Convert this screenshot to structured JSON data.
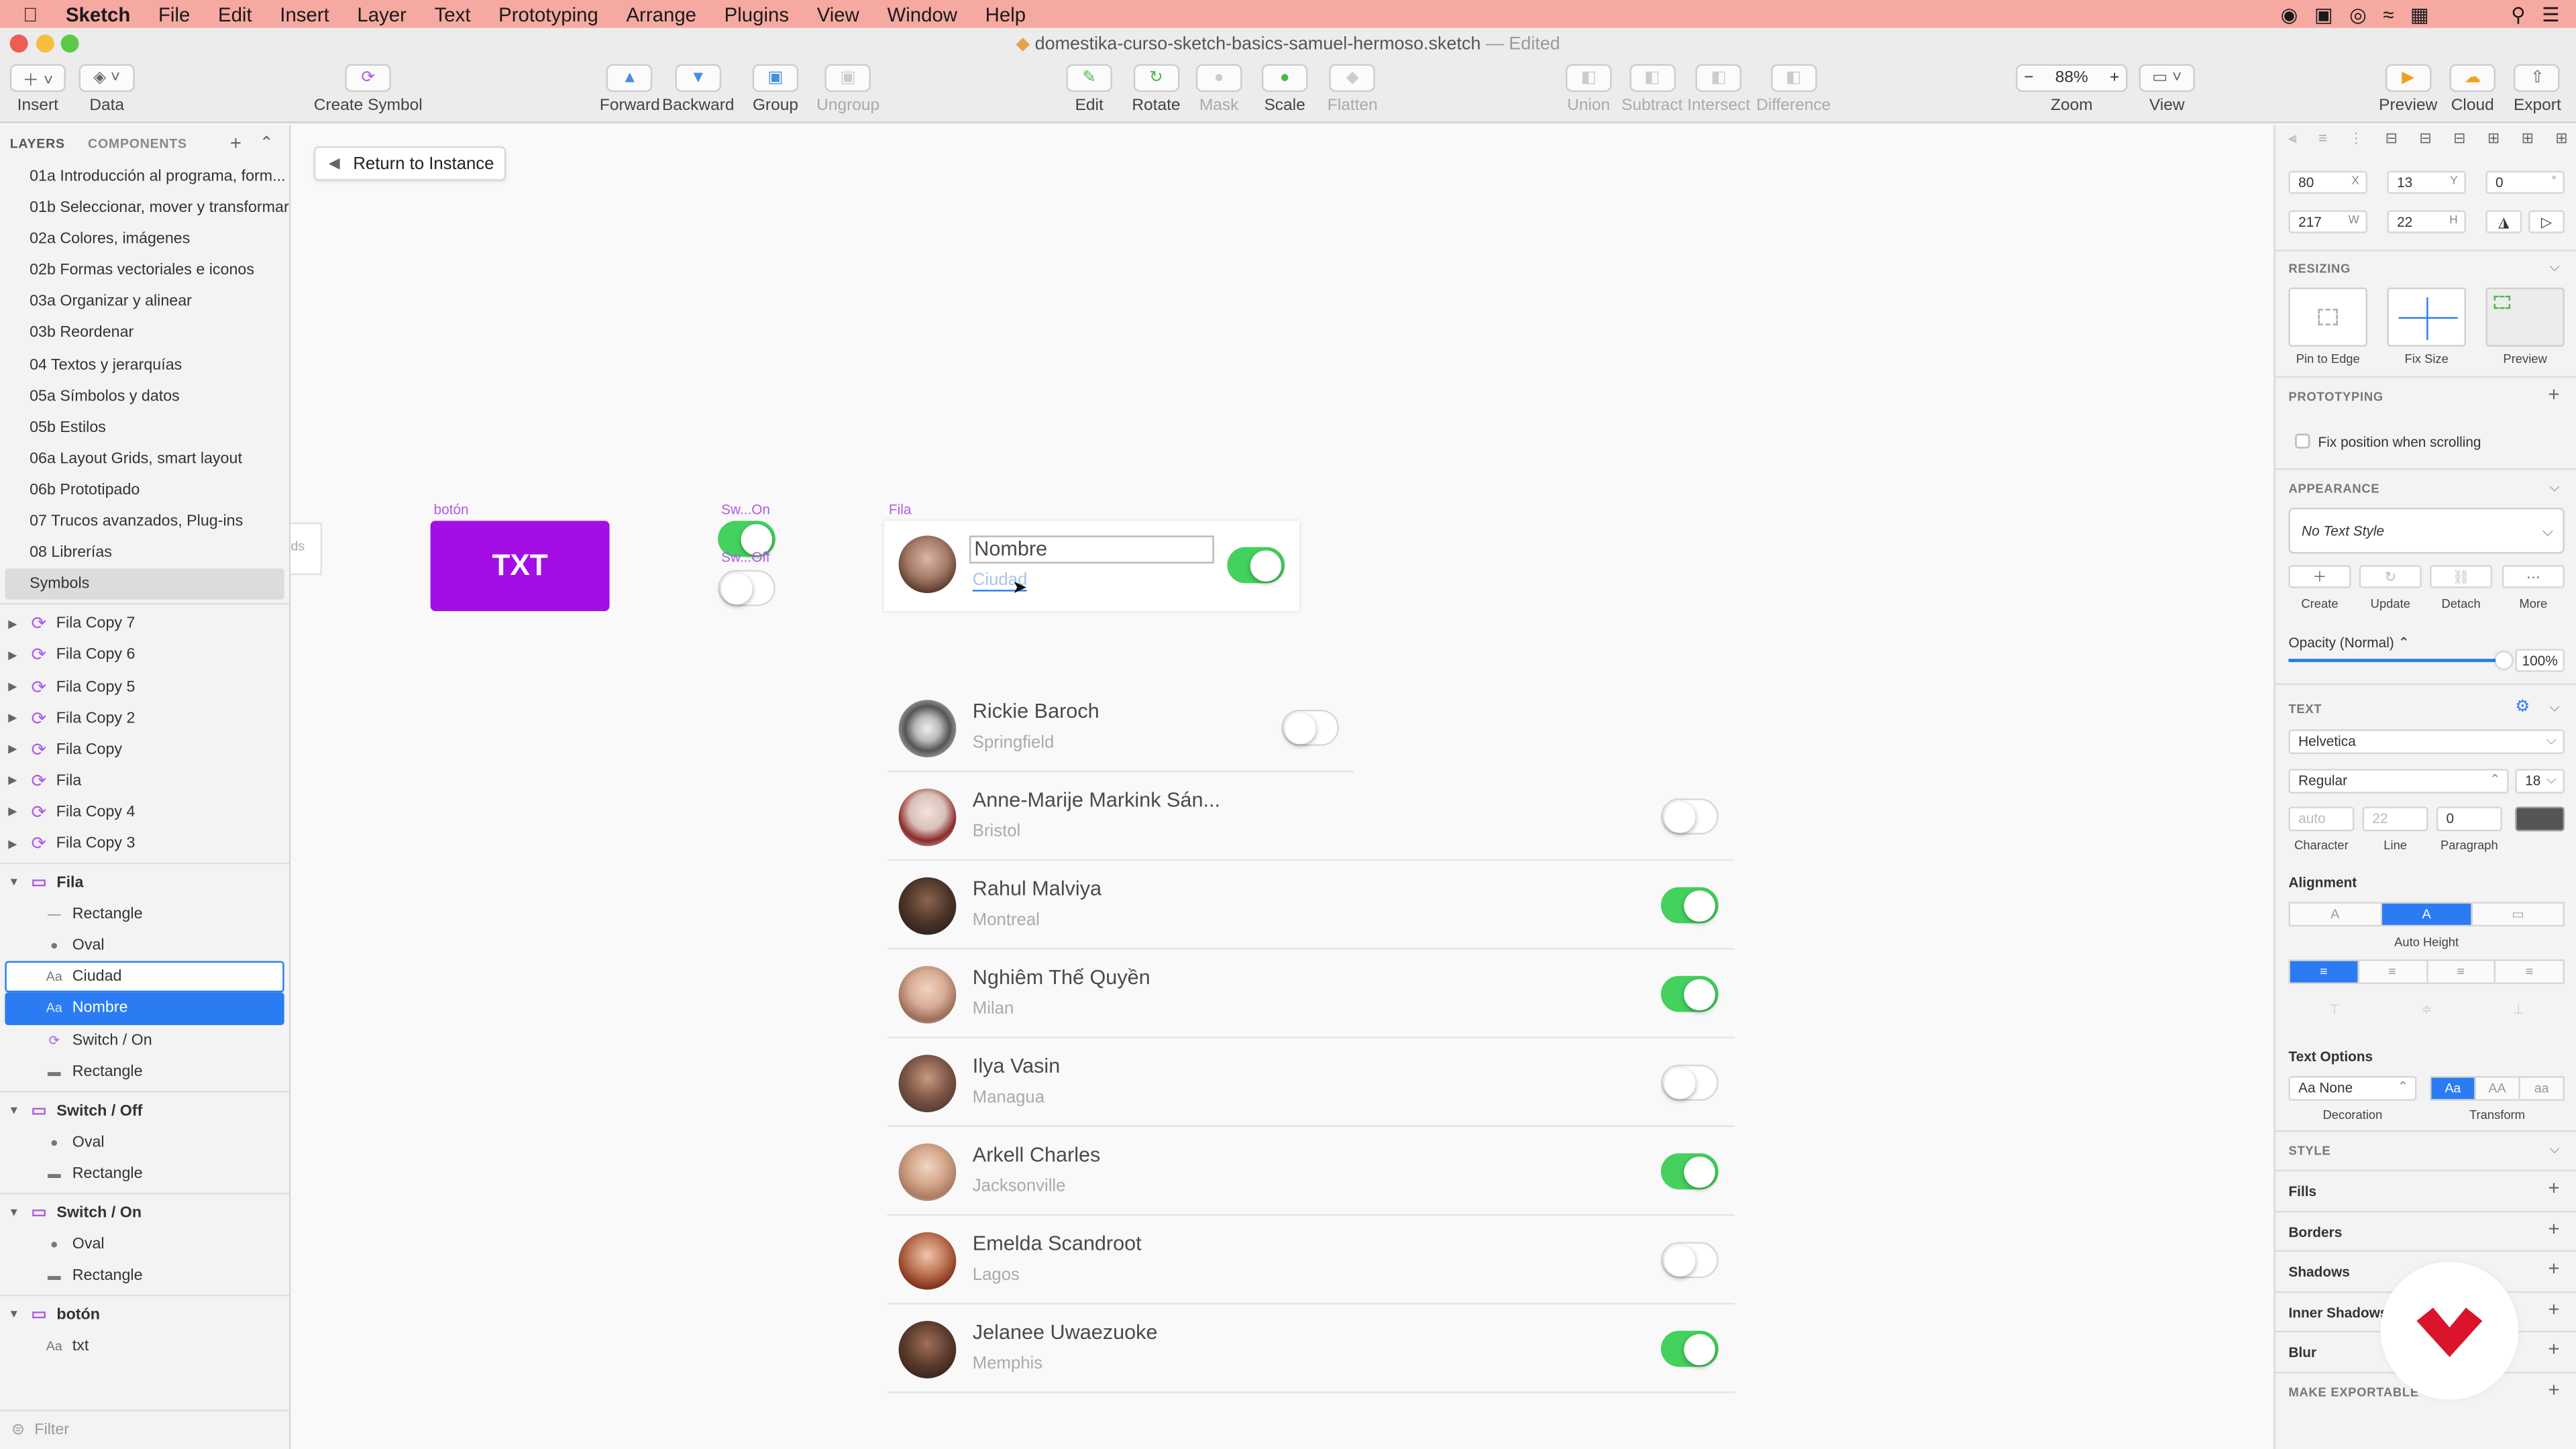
{
  "menubar": {
    "app": "Sketch",
    "items": [
      "File",
      "Edit",
      "Insert",
      "Layer",
      "Text",
      "Prototyping",
      "Arrange",
      "Plugins",
      "View",
      "Window",
      "Help"
    ]
  },
  "window": {
    "title": "domestika-curso-sketch-basics-samuel-hermoso.sketch",
    "status": "— Edited"
  },
  "toolbar": {
    "insert": "Insert",
    "data": "Data",
    "create_symbol": "Create Symbol",
    "forward": "Forward",
    "backward": "Backward",
    "group": "Group",
    "ungroup": "Ungroup",
    "edit": "Edit",
    "rotate": "Rotate",
    "mask": "Mask",
    "scale": "Scale",
    "flatten": "Flatten",
    "union": "Union",
    "subtract": "Subtract",
    "intersect": "Intersect",
    "difference": "Difference",
    "zoom_label": "Zoom",
    "zoom_value": "88%",
    "view": "View",
    "preview": "Preview",
    "cloud": "Cloud",
    "export": "Export"
  },
  "layers_panel": {
    "tab_layers": "LAYERS",
    "tab_components": "COMPONENTS",
    "pages": [
      "01a Introducción al programa, form...",
      "01b Seleccionar, mover y transformar",
      "02a Colores, imágenes",
      "02b Formas vectoriales e iconos",
      "03a Organizar y alinear",
      "03b Reordenar",
      "04 Textos y jerarquías",
      "05a Símbolos y datos",
      "05b Estilos",
      "06a Layout Grids, smart layout",
      "06b Prototipado",
      "07 Trucos avanzados, Plug-ins",
      "08 Librerías",
      "Symbols"
    ],
    "symbol_instances": [
      "Fila Copy 7",
      "Fila Copy 6",
      "Fila Copy 5",
      "Fila Copy 2",
      "Fila Copy",
      "Fila",
      "Fila Copy 4",
      "Fila Copy 3"
    ],
    "artboard_fila": {
      "name": "Fila",
      "children": [
        "Rectangle",
        "Oval",
        "Ciudad",
        "Nombre",
        "Switch / On",
        "Rectangle"
      ]
    },
    "artboard_switch_off": {
      "name": "Switch / Off",
      "children": [
        "Oval",
        "Rectangle"
      ]
    },
    "artboard_switch_on": {
      "name": "Switch / On",
      "children": [
        "Oval",
        "Rectangle"
      ]
    },
    "artboard_boton": {
      "name": "botón",
      "children": [
        "txt"
      ]
    },
    "filter_placeholder": "Filter"
  },
  "canvas": {
    "return_button": "Return to Instance",
    "boton_label": "botón",
    "boton_text": "TXT",
    "switch_on_label": "Sw...On",
    "switch_off_label": "Sw...Off",
    "fila_label": "Fila",
    "fila_name": "Nombre",
    "fila_city": "Ciudad",
    "rows": [
      {
        "name": "Rickie Baroch",
        "city": "Springfield",
        "on": false
      },
      {
        "name": "Anne-Marije Markink Sán...",
        "city": "Bristol",
        "on": false
      },
      {
        "name": "Rahul Malviya",
        "city": "Montreal",
        "on": true
      },
      {
        "name": "Nghiêm Thế Quyền",
        "city": "Milan",
        "on": true
      },
      {
        "name": "Ilya Vasin",
        "city": "Managua",
        "on": false
      },
      {
        "name": "Arkell Charles",
        "city": "Jacksonville",
        "on": true
      },
      {
        "name": "Emelda Scandroot",
        "city": "Lagos",
        "on": false
      },
      {
        "name": "Jelanee Uwaezuoke",
        "city": "Memphis",
        "on": true
      }
    ]
  },
  "inspector": {
    "x": "80",
    "x_unit": "X",
    "y": "13",
    "y_unit": "Y",
    "rotation": "0",
    "rotation_unit": "°",
    "w": "217",
    "w_unit": "W",
    "h": "22",
    "h_unit": "H",
    "resizing": "RESIZING",
    "pin_to_edge": "Pin to Edge",
    "fix_size": "Fix Size",
    "preview": "Preview",
    "prototyping": "PROTOTYPING",
    "fix_position": "Fix position when scrolling",
    "appearance": "APPEARANCE",
    "text_style": "No Text Style",
    "create": "Create",
    "update": "Update",
    "detach": "Detach",
    "more": "More",
    "opacity_label": "Opacity (Normal)",
    "opacity_value": "100%",
    "text_section": "TEXT",
    "font_family": "Helvetica",
    "font_weight": "Regular",
    "font_size": "18",
    "character_placeholder": "auto",
    "line_placeholder": "22",
    "paragraph": "0",
    "character": "Character",
    "line": "Line",
    "paragraph_label": "Paragraph",
    "alignment": "Alignment",
    "auto_height": "Auto Height",
    "text_options": "Text Options",
    "decoration_value": "Aa None",
    "decoration": "Decoration",
    "transform": "Transform",
    "transform_opts": [
      "Aa",
      "AA",
      "aa"
    ],
    "style": "STYLE",
    "fills": "Fills",
    "borders": "Borders",
    "shadows": "Shadows",
    "inner_shadows": "Inner Shadows",
    "blur": "Blur",
    "make_exportable": "MAKE EXPORTABLE"
  },
  "colors": {
    "menubar": "#f6a9a1",
    "accent": "#2b7cf2",
    "symbol": "#b15ae5",
    "toggle_on": "#44d15e",
    "button": "#a40ee5"
  }
}
